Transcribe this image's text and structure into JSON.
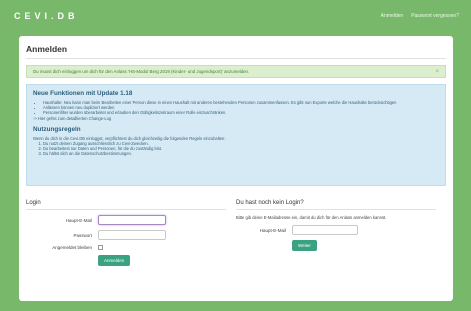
{
  "app": {
    "logo": "CEVI.DB"
  },
  "topnav": {
    "login_link": "Anmelden",
    "forgot_link": "Passwort vergessen?"
  },
  "page": {
    "title": "Anmelden"
  },
  "notice": {
    "text": "Du musst dich einloggen um dich für den Anlass 'HS-Modul Berg 2019 (Kinder- und Jugendsport)' anzumelden.",
    "close": "×"
  },
  "info": {
    "updates_title": "Neue Funktionen mit Update 1.18",
    "updates": [
      "Haushalte: Neu kann man beim Bearbeiten einer Person diese in einen Haushalt mit anderen bestehenden Personen zusammenfassen. Es gibt nun Exporte welche die Haushalte berücksichtigen",
      "Anlässen können neu dupliziert werden",
      "Personenfilter wurden überarbeitet und erlauben den Gültigkeitszeitraum einer Rolle einzuschränken."
    ],
    "changelog": "-> Hier gehts zum detaillierten Change-Log",
    "rules_title": "Nutzungsregeln",
    "rules_intro": "Wenn du dich in die Cevi.DB einloggst, verpflichtest du dich gleichzeitig die folgenden Regeln einzuhalten:",
    "rules": [
      "Du nutzt deinen Zugang ausschliesslich zu Cevi-Zwecken.",
      "Du bearbeitest nur Daten und Personen, für die du zuständig bist.",
      "Du hältst dich an die Datenschutzbestimmungen."
    ]
  },
  "login": {
    "title": "Login",
    "email_label": "Haupt-E-Mail",
    "password_label": "Passwort",
    "remember_label": "Angemeldet bleiben",
    "submit": "Anmelden"
  },
  "register": {
    "title": "Du hast noch kein Login?",
    "text": "Bitte gib deine E-Mailadresse ein, damit du dich für den Anlass anmelden kannst.",
    "email_label": "Haupt-E-Mail",
    "submit": "Weiter"
  },
  "colors": {
    "background": "#77b86a",
    "button": "#3aa181",
    "notice": "#dbefcf",
    "info": "#d5eaf4"
  }
}
